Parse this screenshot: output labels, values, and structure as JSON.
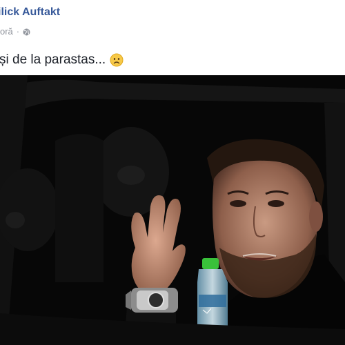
{
  "post": {
    "author_name": "ilick Auftakt",
    "timestamp": "oră",
    "separator": "·",
    "privacy_icon": "globe-icon",
    "text": "și de la parastas...",
    "emoji": "sad-face-emoji"
  },
  "photo": {
    "subject": "man waving from inside a car at night",
    "accent_colors": {
      "bottle_cap": "#39c13a",
      "link": "#365899",
      "meta": "#90949c"
    }
  }
}
